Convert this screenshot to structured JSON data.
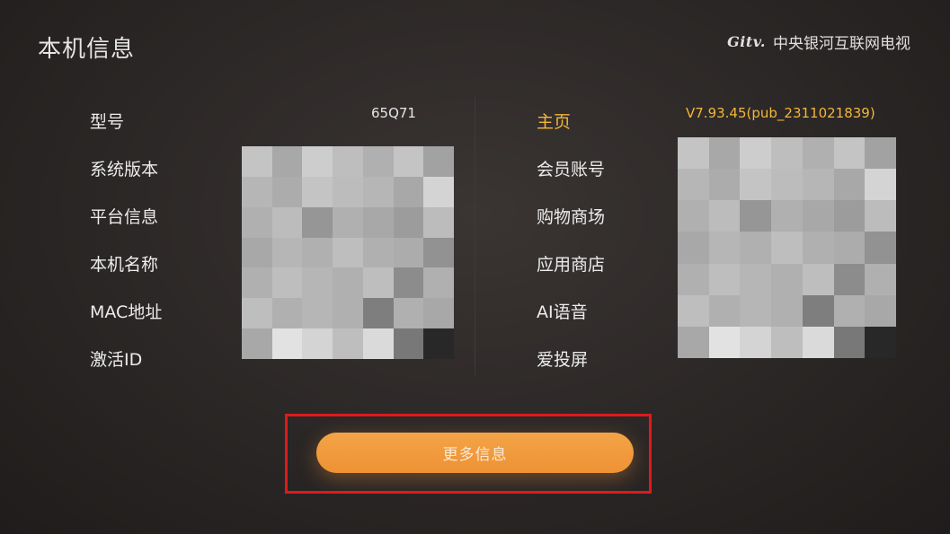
{
  "header": {
    "title": "本机信息",
    "brand_logo": "Gitv.",
    "brand_name": "中央银河互联网电视"
  },
  "left_list": {
    "items": [
      {
        "label": "型号",
        "value": "65Q71"
      },
      {
        "label": "系统版本"
      },
      {
        "label": "平台信息"
      },
      {
        "label": "本机名称"
      },
      {
        "label": "MAC地址"
      },
      {
        "label": "激活ID"
      }
    ]
  },
  "right_list": {
    "items": [
      {
        "label": "主页",
        "value": "V7.93.45(pub_2311021839)",
        "active": true
      },
      {
        "label": "会员账号"
      },
      {
        "label": "购物商场"
      },
      {
        "label": "应用商店"
      },
      {
        "label": "AI语音"
      },
      {
        "label": "爱投屏"
      }
    ]
  },
  "more_button": {
    "label": "更多信息"
  },
  "colors": {
    "accent_text": "#f3b63a",
    "button": "#ef9a3d",
    "highlight_box": "#e0191c"
  }
}
